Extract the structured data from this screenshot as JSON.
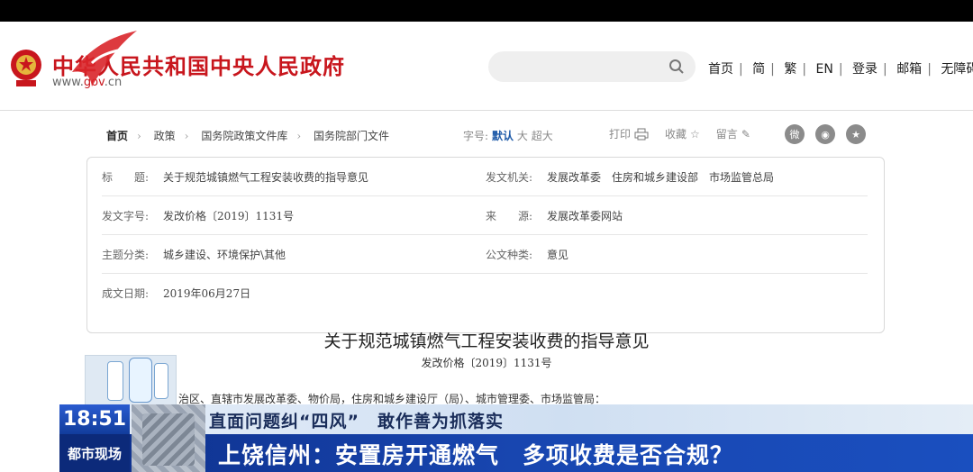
{
  "header": {
    "site_title": "中华人民共和国中央人民政府",
    "site_url_prefix": "www.",
    "site_url_accent": "gov",
    "site_url_suffix": ".cn",
    "links": [
      "首页",
      "简",
      "繁",
      "EN",
      "登录",
      "邮箱",
      "无障碍"
    ]
  },
  "breadcrumb": [
    "首页",
    "政策",
    "国务院政策文件库",
    "国务院部门文件"
  ],
  "font_size": {
    "label": "字号:",
    "options": [
      "默认",
      "大",
      "超大"
    ],
    "active": "默认"
  },
  "tools": {
    "print": "打印",
    "favorite": "收藏",
    "comment": "留言"
  },
  "share_icons": [
    "weibo-icon",
    "wechat-icon",
    "star-icon"
  ],
  "meta": {
    "title_label": "标　　题:",
    "title_value": "关于规范城镇燃气工程安装收费的指导意见",
    "issuer_label": "发文机关:",
    "issuer_value": "发展改革委　住房和城乡建设部　市场监管总局",
    "docno_label": "发文字号:",
    "docno_value": "发改价格〔2019〕1131号",
    "source_label": "来　　源:",
    "source_value": "发展改革委网站",
    "topic_label": "主题分类:",
    "topic_value": "城乡建设、环境保护\\其他",
    "type_label": "公文种类:",
    "type_value": "意见",
    "date_label": "成文日期:",
    "date_value": "2019年06月27日"
  },
  "document": {
    "heading": "关于规范城镇燃气工程安装收费的指导意见",
    "number": "发改价格〔2019〕1131号",
    "first_line": "治区、直辖市发展改革委、物价局，住房和城乡建设厅（局）、城市管理委、市场监管局："
  },
  "ticker": {
    "time": "18:51",
    "brand": "都市现场",
    "line1": "直面问题纠“四风”　敢作善为抓落实",
    "line2": "上饶信州：安置房开通燃气　多项收费是否合规？"
  },
  "colors": {
    "gov_red": "#c8161d",
    "ticker_blue": "#1846b0",
    "link_blue": "#1e5aa8"
  }
}
